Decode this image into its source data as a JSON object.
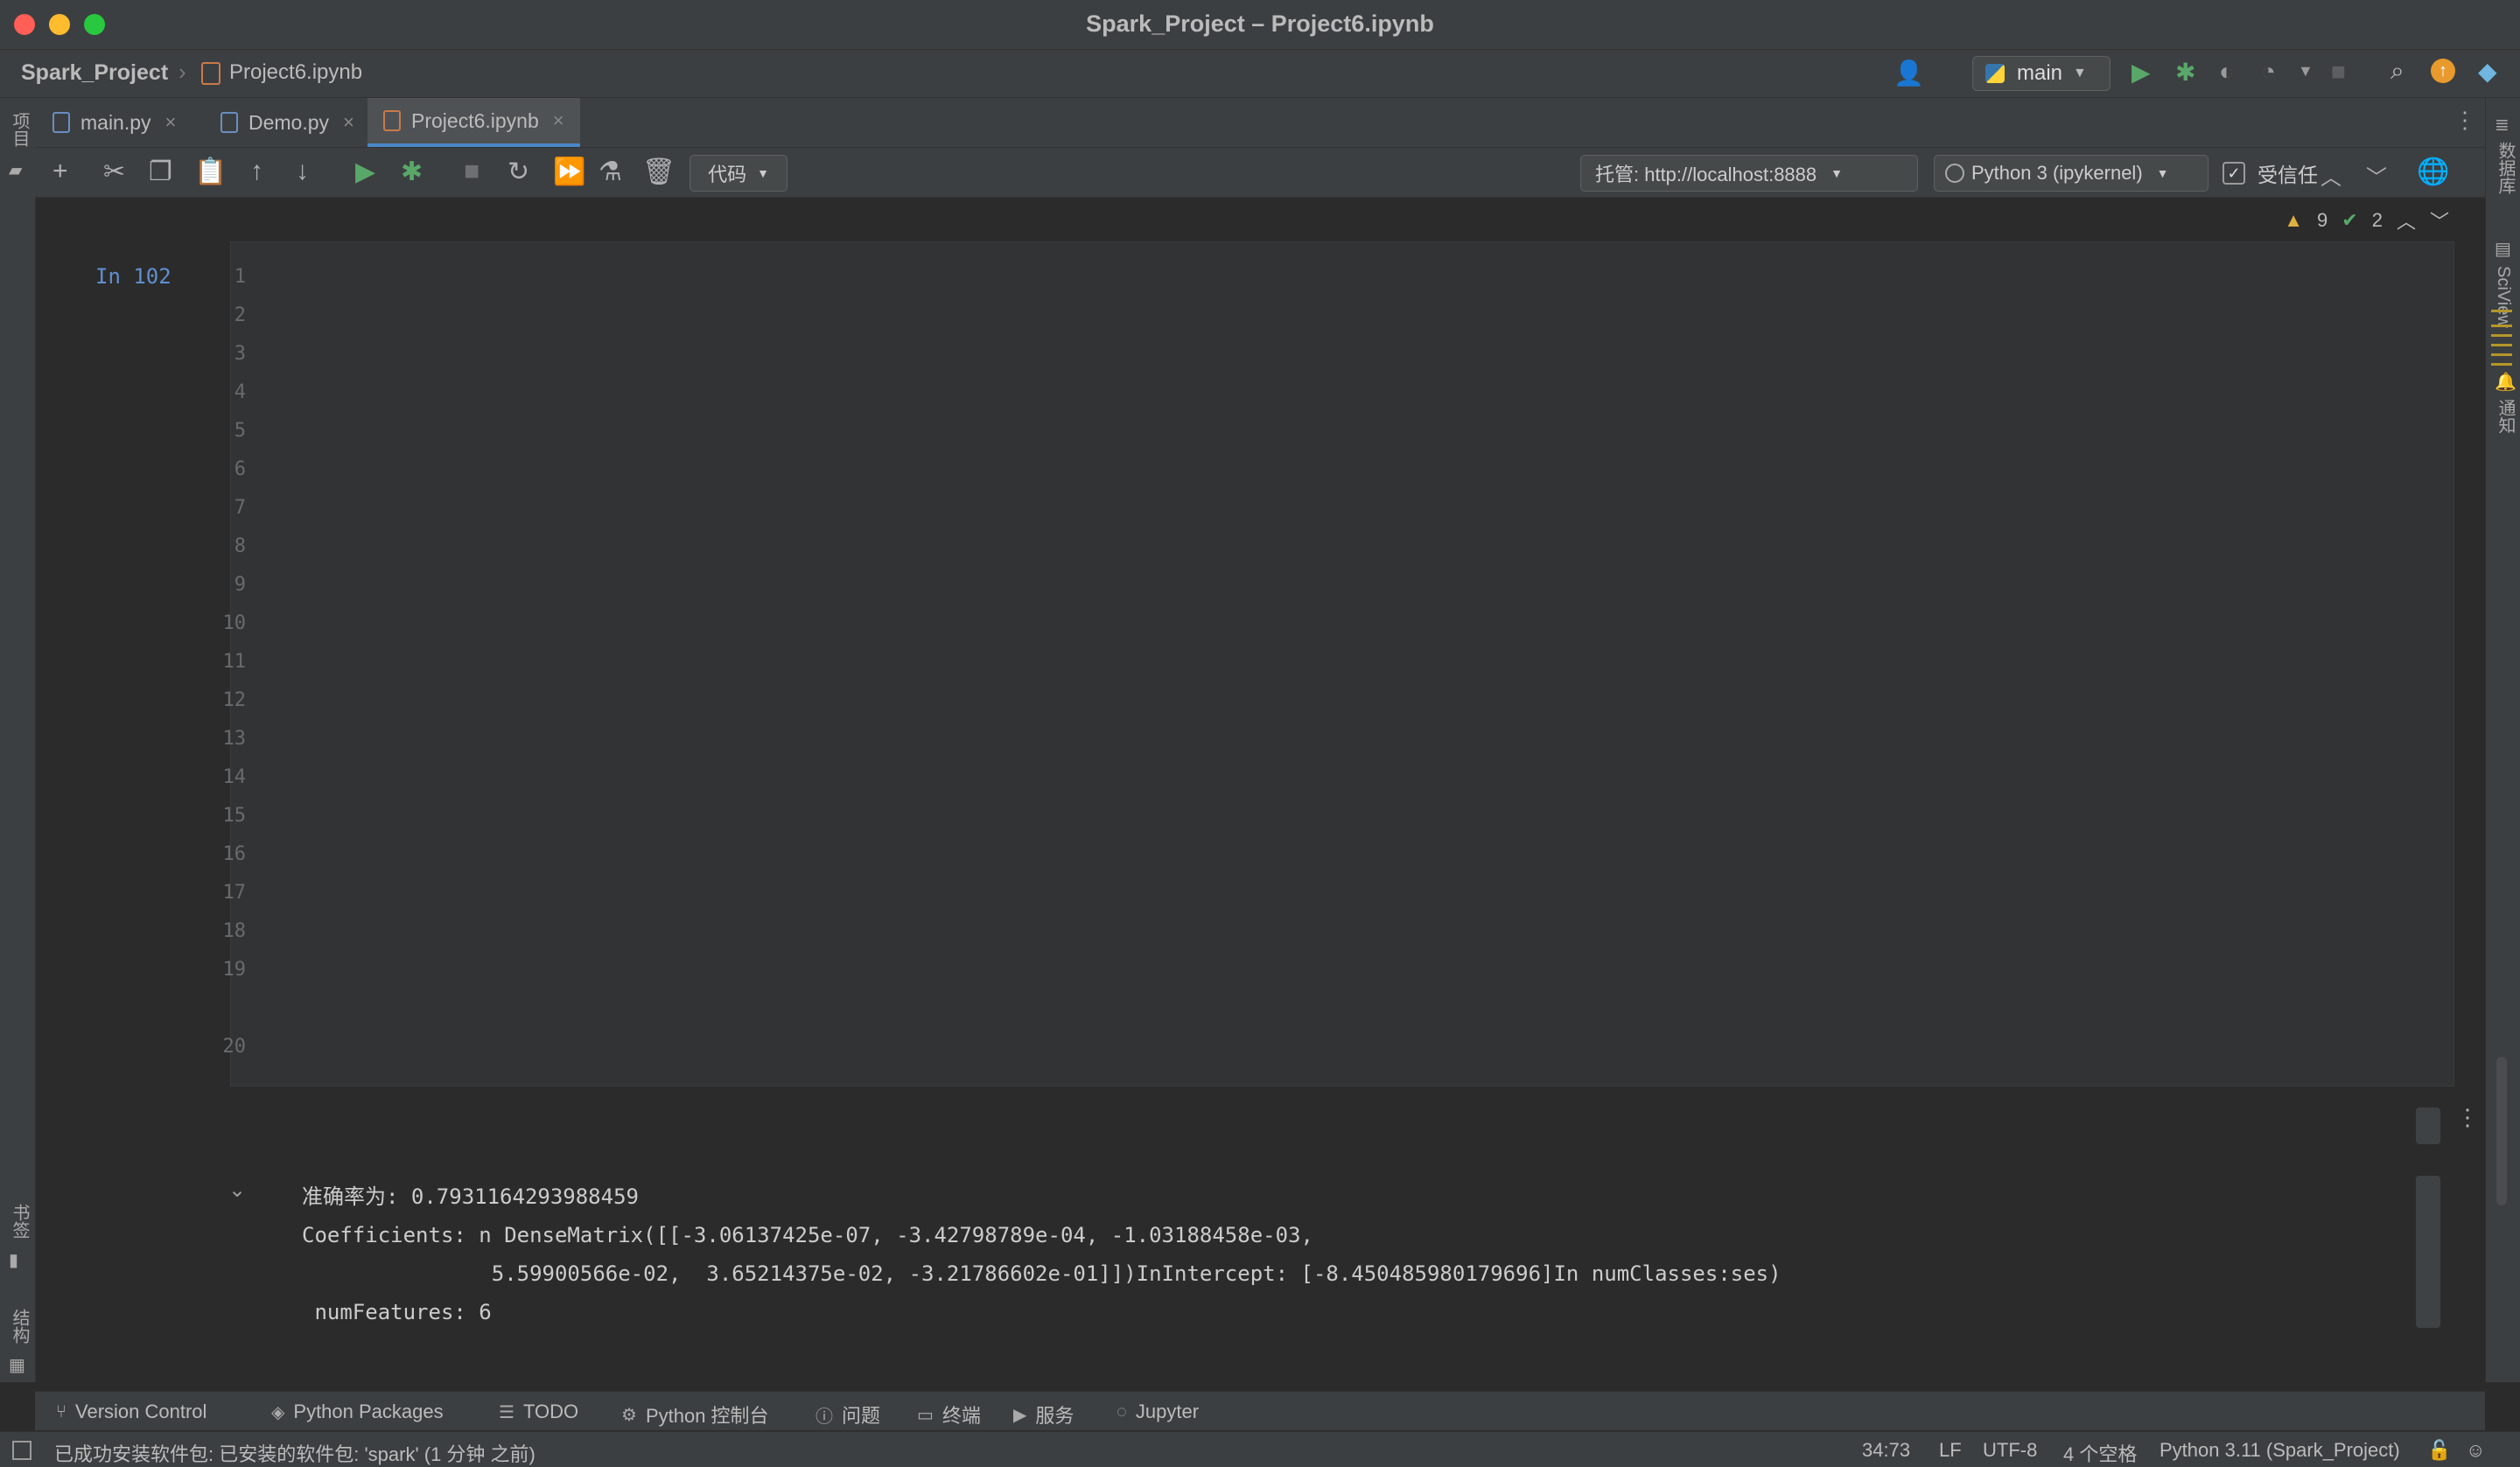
{
  "window": {
    "title": "Spark_Project – Project6.ipynb"
  },
  "nav": {
    "project": "Spark_Project",
    "file": "Project6.ipynb",
    "branch": "main"
  },
  "tabs": [
    {
      "label": "main.py"
    },
    {
      "label": "Demo.py"
    },
    {
      "label": "Project6.ipynb"
    }
  ],
  "toolbar": {
    "cell_type": "代码",
    "host": "托管: http://localhost:8888",
    "kernel": "Python 3 (ipykernel)",
    "trusted_label": "受信任"
  },
  "left_strip": {
    "project": "项目",
    "bookmarks": "书签",
    "structure": "结构"
  },
  "right_strip": {
    "database": "数据库",
    "sciview": "SciView",
    "notifications": "通知"
  },
  "inspections": {
    "warnings": "9",
    "ok": "2"
  },
  "cell": {
    "prompt": "In 102",
    "line_numbers": [
      "1",
      "2",
      "3",
      "4",
      "5",
      "6",
      "7",
      "8",
      "9",
      "10",
      "11",
      "12",
      "13",
      "14",
      "15",
      "16",
      "17",
      "18",
      "19",
      "20"
    ]
  },
  "output": {
    "lines": [
      "准确率为: 0.7931164293988459",
      "Coefficients: n DenseMatrix([[-3.06137425e-07, -3.42798789e-04, -1.03188458e-03,",
      "               5.59900566e-02,  3.65214375e-02, -3.21786602e-01]])InIntercept: [-8.450485980179696]In numClasses:ses)",
      " numFeatures: 6"
    ]
  },
  "toolwindows": [
    {
      "label": "Version Control"
    },
    {
      "label": "Python Packages"
    },
    {
      "label": "TODO"
    },
    {
      "label": "Python 控制台"
    },
    {
      "label": "问题"
    },
    {
      "label": "终端"
    },
    {
      "label": "服务"
    },
    {
      "label": "Jupyter"
    }
  ],
  "status": {
    "message": "已成功安装软件包: 已安装的软件包: 'spark' (1 分钟 之前)",
    "position": "34:73",
    "line_sep": "LF",
    "encoding": "UTF-8",
    "indent": "4 个空格",
    "interpreter": "Python 3.11 (Spark_Project)"
  },
  "colors": {
    "background": "#2b2b2b",
    "panel": "#3c3f41",
    "cell": "#313335",
    "string": "#6a8759",
    "number": "#6897bb",
    "builtin": "#8888c6",
    "prompt": "#5f8fd0"
  }
}
